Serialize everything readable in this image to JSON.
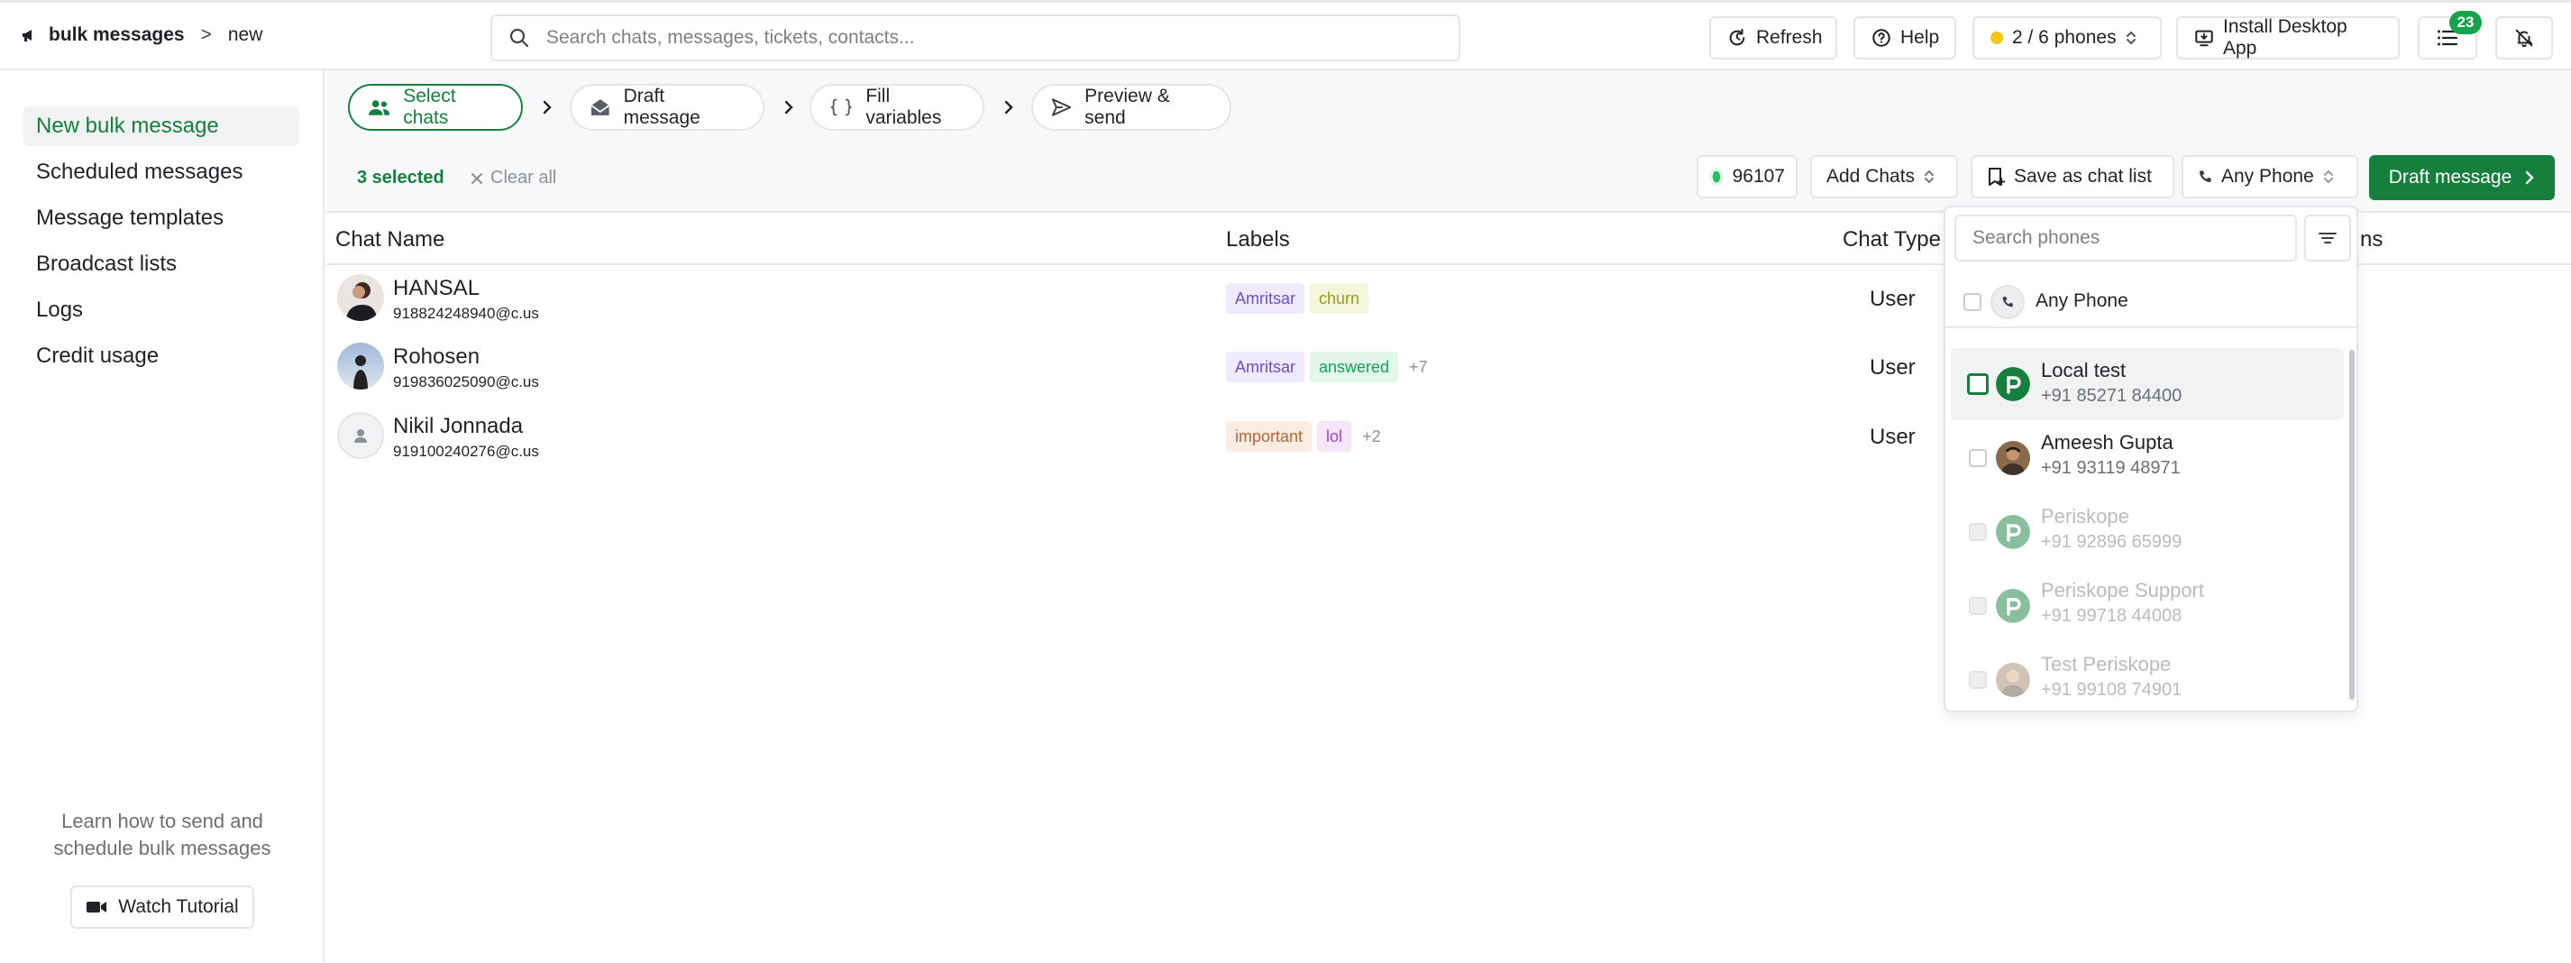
{
  "topbar": {
    "breadcrumb": [
      "bulk messages",
      ">",
      "new"
    ],
    "search_placeholder": "Search chats, messages, tickets, contacts...",
    "refresh_label": "Refresh",
    "help_label": "Help",
    "phones_label": "2 / 6 phones",
    "install_label": "Install Desktop App",
    "notifications_count": "23"
  },
  "sidebar": {
    "items": [
      {
        "label": "New bulk message",
        "active": true
      },
      {
        "label": "Scheduled messages"
      },
      {
        "label": "Message templates"
      },
      {
        "label": "Broadcast lists"
      },
      {
        "label": "Logs"
      },
      {
        "label": "Credit usage"
      }
    ],
    "learn_text": "Learn how to send and schedule bulk messages",
    "tutorial_label": "Watch Tutorial"
  },
  "steps": [
    {
      "label": "Select chats",
      "icon": "users-icon",
      "active": true
    },
    {
      "label": "Draft message",
      "icon": "envelope-open-icon"
    },
    {
      "label": "Fill variables",
      "icon": "braces-icon"
    },
    {
      "label": "Preview & send",
      "icon": "send-icon"
    }
  ],
  "actionbar": {
    "selected": "3 selected",
    "clear_all": "Clear all",
    "credits": "96107",
    "add_chats": "Add Chats",
    "save_list": "Save as chat list",
    "any_phone": "Any Phone",
    "draft_message": "Draft message"
  },
  "table": {
    "columns": [
      "Chat Name",
      "Labels",
      "Chat Type",
      "ns"
    ],
    "rows": [
      {
        "name": "HANSAL",
        "id": "918824248940@c.us",
        "labels": [
          {
            "text": "Amritsar",
            "color": "#6d4fc2",
            "bg": "#efeaff"
          },
          {
            "text": "churn",
            "color": "#9a9a1a",
            "bg": "#f4f6dc"
          }
        ],
        "more": "",
        "type": "User"
      },
      {
        "name": "Rohosen",
        "id": "919836025090@c.us",
        "labels": [
          {
            "text": "Amritsar",
            "color": "#6d4fc2",
            "bg": "#efeaff"
          },
          {
            "text": "answered",
            "color": "#16a05a",
            "bg": "#e2f7ea"
          }
        ],
        "more": "+7",
        "type": "User"
      },
      {
        "name": "Nikil Jonnada",
        "id": "919100240276@c.us",
        "labels": [
          {
            "text": "important",
            "color": "#b0683a",
            "bg": "#fbece2"
          },
          {
            "text": "lol",
            "color": "#a23fc9",
            "bg": "#f5e6fc"
          }
        ],
        "more": "+2",
        "type": "User"
      }
    ]
  },
  "phone_dropdown": {
    "search_placeholder": "Search phones",
    "any_phone": "Any Phone",
    "phones": [
      {
        "name": "Local test",
        "number": "+91 85271 84400"
      },
      {
        "name": "Ameesh Gupta",
        "number": "+91 93119 48971"
      },
      {
        "name": "Periskope",
        "number": "+91 92896 65999"
      },
      {
        "name": "Periskope Support",
        "number": "+91 99718 44008"
      },
      {
        "name": "Test Periskope",
        "number": "+91 99108 74901"
      }
    ]
  },
  "colors": {
    "brand_green": "#15803d",
    "border": "#e3e5e8"
  }
}
